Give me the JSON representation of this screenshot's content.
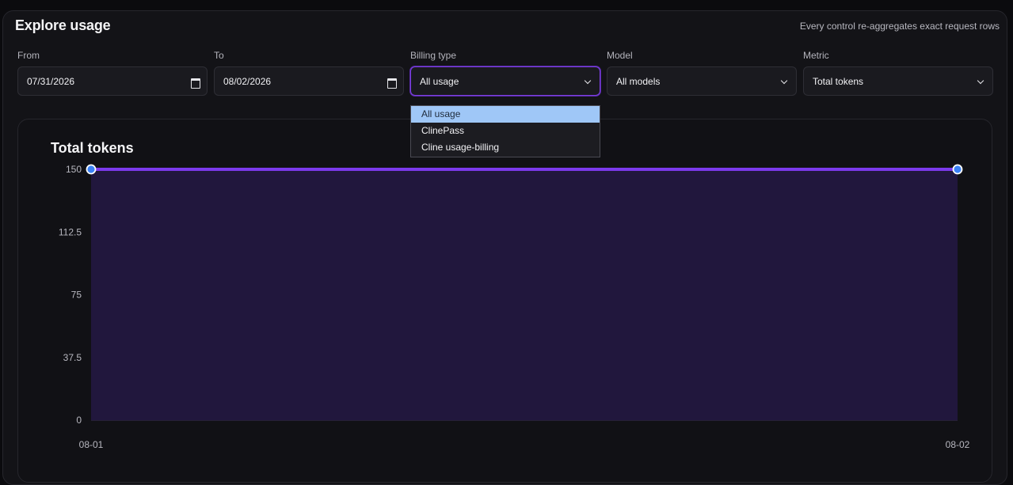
{
  "header": {
    "title": "Explore usage",
    "subtitle": "Every control re-aggregates exact request rows"
  },
  "filters": {
    "from": {
      "label": "From",
      "value": "07/31/2026",
      "icon": "calendar-icon"
    },
    "to": {
      "label": "To",
      "value": "08/02/2026",
      "icon": "calendar-icon"
    },
    "billing_type": {
      "label": "Billing type",
      "value": "All usage",
      "icon": "chevron-down-icon",
      "open": true,
      "options": [
        "All usage",
        "ClinePass",
        "Cline usage-billing"
      ],
      "selected_index": 0
    },
    "model": {
      "label": "Model",
      "value": "All models",
      "icon": "chevron-down-icon"
    },
    "metric": {
      "label": "Metric",
      "value": "Total tokens",
      "icon": "chevron-down-icon"
    }
  },
  "colors": {
    "accent": "#7c3aed",
    "area_fill": "#21173d",
    "point_fill": "#3b82f6",
    "highlight": "#9fc7f7"
  },
  "chart_data": {
    "type": "area",
    "title": "Total tokens",
    "categories": [
      "08-01",
      "08-02"
    ],
    "values": [
      150,
      150
    ],
    "ylim": [
      0,
      150
    ],
    "yticks": [
      "0",
      "37.5",
      "75",
      "112.5",
      "150"
    ],
    "grid": true,
    "xlabel": "",
    "ylabel": ""
  }
}
